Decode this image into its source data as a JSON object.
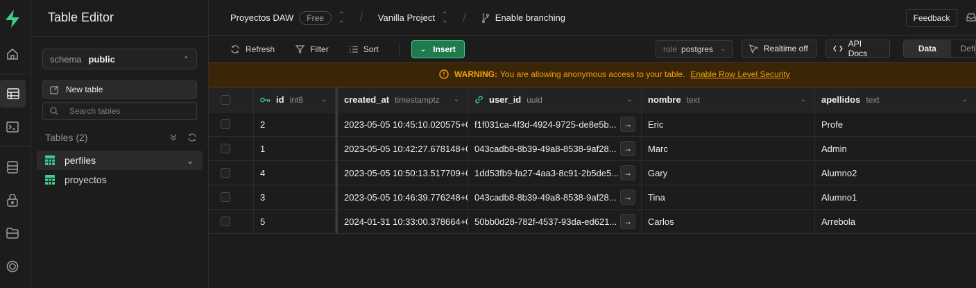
{
  "app": {
    "title": "Table Editor",
    "brand_color": "#3ecf8e"
  },
  "rail": {
    "icons": [
      "supabase-logo-icon",
      "home-icon",
      "table-editor-icon",
      "sql-editor-icon",
      "database-icon",
      "auth-icon",
      "storage-icon",
      "realtime-icon"
    ]
  },
  "topbar": {
    "org": "Proyectos DAW",
    "plan": "Free",
    "project": "Vanilla Project",
    "branching": "Enable branching",
    "feedback": "Feedback"
  },
  "sidebar": {
    "schema_label": "schema",
    "schema_value": "public",
    "new_table": "New table",
    "search_placeholder": "Search tables",
    "tables_header": "Tables (2)",
    "tables": [
      {
        "name": "perfiles",
        "selected": true
      },
      {
        "name": "proyectos",
        "selected": false
      }
    ]
  },
  "toolbar": {
    "refresh": "Refresh",
    "filter": "Filter",
    "sort": "Sort",
    "insert": "Insert",
    "role_label": "role",
    "role_value": "postgres",
    "realtime": "Realtime off",
    "api_docs": "API Docs",
    "view_data": "Data",
    "view_def": "Defi"
  },
  "warning": {
    "label": "WARNING:",
    "text": "You are allowing anonymous access to your table.",
    "link": "Enable Row Level Security"
  },
  "table": {
    "columns": [
      {
        "name": "id",
        "type": "int8"
      },
      {
        "name": "created_at",
        "type": "timestamptz"
      },
      {
        "name": "user_id",
        "type": "uuid"
      },
      {
        "name": "nombre",
        "type": "text"
      },
      {
        "name": "apellidos",
        "type": "text"
      }
    ],
    "rows": [
      {
        "id": "2",
        "created_at": "2023-05-05 10:45:10.020575+0",
        "user_id": "f1f031ca-4f3d-4924-9725-de8e5b...",
        "nombre": "Eric",
        "apellidos": "Profe"
      },
      {
        "id": "1",
        "created_at": "2023-05-05 10:42:27.678148+0",
        "user_id": "043cadb8-8b39-49a8-8538-9af28...",
        "nombre": "Marc",
        "apellidos": "Admin"
      },
      {
        "id": "4",
        "created_at": "2023-05-05 10:50:13.517709+0",
        "user_id": "1dd53fb9-fa27-4aa3-8c91-2b5de5...",
        "nombre": "Gary",
        "apellidos": "Alumno2"
      },
      {
        "id": "3",
        "created_at": "2023-05-05 10:46:39.776248+0",
        "user_id": "043cadb8-8b39-49a8-8538-9af28...",
        "nombre": "Tina",
        "apellidos": "Alumno1"
      },
      {
        "id": "5",
        "created_at": "2024-01-31 10:33:00.378664+0",
        "user_id": "50bb0d28-782f-4537-93da-ed621...",
        "nombre": "Carlos",
        "apellidos": "Arrebola"
      }
    ]
  }
}
